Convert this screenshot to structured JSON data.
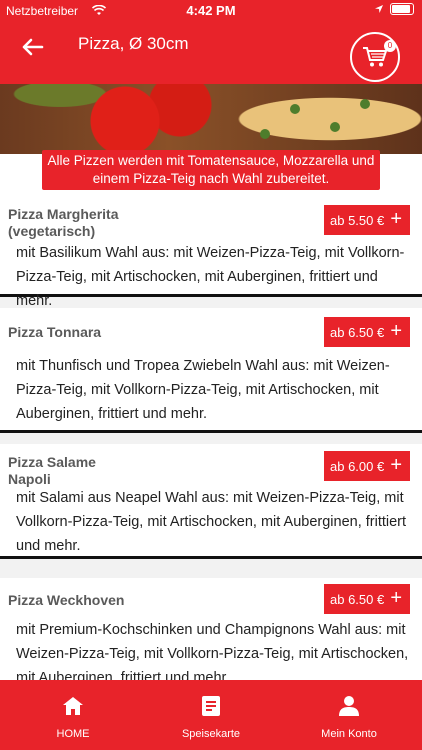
{
  "status": {
    "carrier": "Netzbetreiber",
    "time": "4:42 PM"
  },
  "header": {
    "title": "Pizza, Ø 30cm",
    "cart_count": "0"
  },
  "notice": "Alle Pizzen werden mit Tomatensauce, Mozzarella und einem Pizza-Teig nach Wahl zubereitet.",
  "items": [
    {
      "name": "Pizza Margherita (vegetarisch)",
      "price": "ab 5.50 €",
      "description": "mit Basilikum Wahl aus: mit Weizen-Pizza-Teig, mit Vollkorn-Pizza-Teig, mit Artischocken, mit Auberginen, frittiert und mehr."
    },
    {
      "name": "Pizza Tonnara",
      "price": "ab 6.50 €",
      "description": "mit Thunfisch und Tropea Zwiebeln Wahl aus: mit Weizen-Pizza-Teig, mit Vollkorn-Pizza-Teig, mit Artischocken, mit Auberginen, frittiert und mehr."
    },
    {
      "name": "Pizza Salame Napoli",
      "price": "ab 6.00 €",
      "description": "mit Salami aus Neapel Wahl aus: mit Weizen-Pizza-Teig, mit Vollkorn-Pizza-Teig, mit Artischocken, mit Auberginen, frittiert und mehr."
    },
    {
      "name": "Pizza Weckhoven",
      "price": "ab 6.50 €",
      "description": "mit Premium-Kochschinken und Champignons Wahl aus: mit Weizen-Pizza-Teig, mit Vollkorn-Pizza-Teig, mit Artischocken, mit Auberginen, frittiert und mehr."
    }
  ],
  "tabs": {
    "home": "HOME",
    "menu": "Speisekarte",
    "account": "Mein Konto"
  },
  "colors": {
    "accent": "#e8232a",
    "text": "#222222",
    "name_text": "#5a5a5a"
  }
}
